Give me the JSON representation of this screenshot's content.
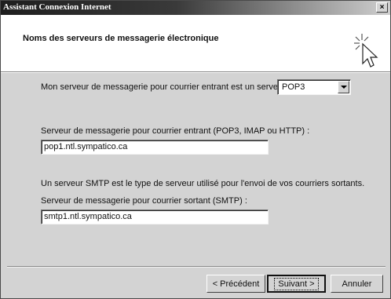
{
  "window": {
    "title": "Assistant Connexion Internet",
    "close_glyph": "×"
  },
  "header": {
    "title": "Noms des serveurs de messagerie électronique",
    "icon": "wizard-cursor-icon"
  },
  "form": {
    "incoming_type_label": "Mon serveur de messagerie pour courrier entrant est un serveur",
    "incoming_type_value": "POP3",
    "incoming_server_label": "Serveur de messagerie pour courrier entrant (POP3, IMAP ou HTTP) :",
    "incoming_server_value": "pop1.ntl.sympatico.ca",
    "smtp_info": "Un serveur SMTP est le type de serveur utilisé pour l'envoi de vos courriers sortants.",
    "outgoing_server_label": "Serveur de messagerie pour courrier sortant (SMTP) :",
    "outgoing_server_value": "smtp1.ntl.sympatico.ca"
  },
  "buttons": {
    "back": "< Précédent",
    "next": "Suivant >",
    "cancel": "Annuler"
  }
}
